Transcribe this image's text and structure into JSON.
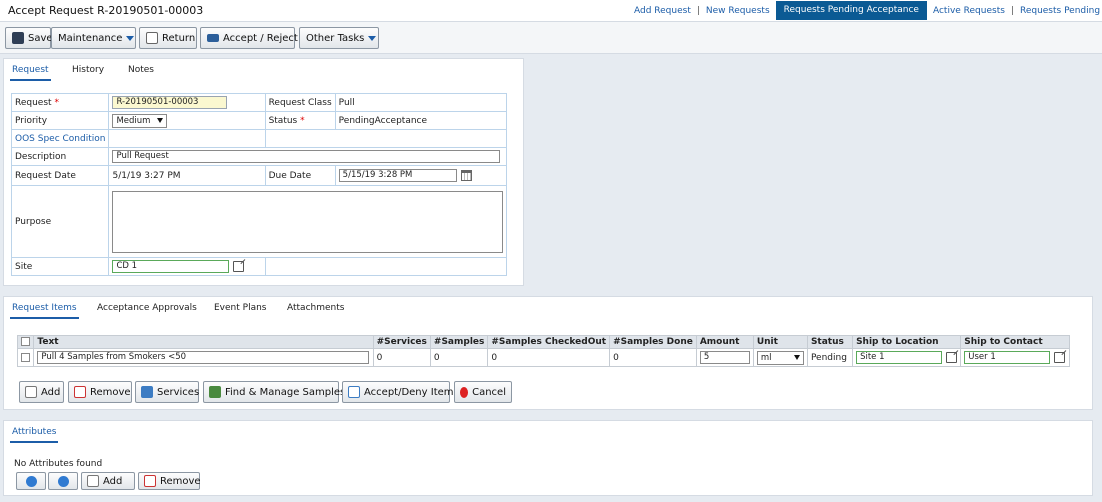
{
  "header": {
    "title": "Accept Request R-20190501-00003",
    "nav": [
      {
        "label": "Add Request",
        "active": false
      },
      {
        "label": "New Requests",
        "active": false
      },
      {
        "label": "Requests Pending Acceptance",
        "active": true
      },
      {
        "label": "Active Requests",
        "active": false
      },
      {
        "label": "Requests Pending Relea",
        "active": false
      }
    ]
  },
  "toolbar": {
    "save": "Save",
    "maintenance": "Maintenance",
    "return": "Return",
    "accept_reject": "Accept / Reject",
    "other_tasks": "Other Tasks"
  },
  "request_tabs": [
    "Request",
    "History",
    "Notes"
  ],
  "form": {
    "request_label": "Request",
    "request_value": "R-20190501-00003",
    "request_class_label": "Request Class",
    "request_class_value": "Pull",
    "priority_label": "Priority",
    "priority_value": "Medium",
    "status_label": "Status",
    "status_value": "PendingAcceptance",
    "oos_label": "OOS Spec Condition",
    "description_label": "Description",
    "description_value": "Pull Request",
    "request_date_label": "Request Date",
    "request_date_value": "5/1/19 3:27 PM",
    "due_date_label": "Due Date",
    "due_date_value": "5/15/19 3:28 PM",
    "purpose_label": "Purpose",
    "purpose_value": "",
    "site_label": "Site",
    "site_value": "CD 1"
  },
  "items_tabs": [
    "Request Items",
    "Acceptance Approvals",
    "Event Plans",
    "Attachments"
  ],
  "items_table": {
    "columns": [
      "Text",
      "#Services",
      "#Samples",
      "#Samples CheckedOut",
      "#Samples Done",
      "Amount",
      "Unit",
      "Status",
      "Ship to Location",
      "Ship to Contact"
    ],
    "rows": [
      {
        "text": "Pull 4 Samples from Smokers <50",
        "services": "0",
        "samples": "0",
        "checked_out": "0",
        "done": "0",
        "amount": "5",
        "unit": "ml",
        "status": "Pending",
        "ship_location": "Site 1",
        "ship_contact": "User 1"
      }
    ]
  },
  "items_buttons": {
    "add": "Add",
    "remove": "Remove",
    "services": "Services",
    "find_manage": "Find & Manage Samples",
    "accept_deny": "Accept/Deny Item",
    "cancel": "Cancel"
  },
  "attributes": {
    "tab": "Attributes",
    "empty_text": "No Attributes found",
    "add": "Add",
    "remove": "Remove"
  },
  "colors": {
    "accent": "#1c5da8",
    "nav_active_bg": "#0b5a94",
    "page_bg": "#e6ebf1",
    "required": "#dd0000"
  }
}
